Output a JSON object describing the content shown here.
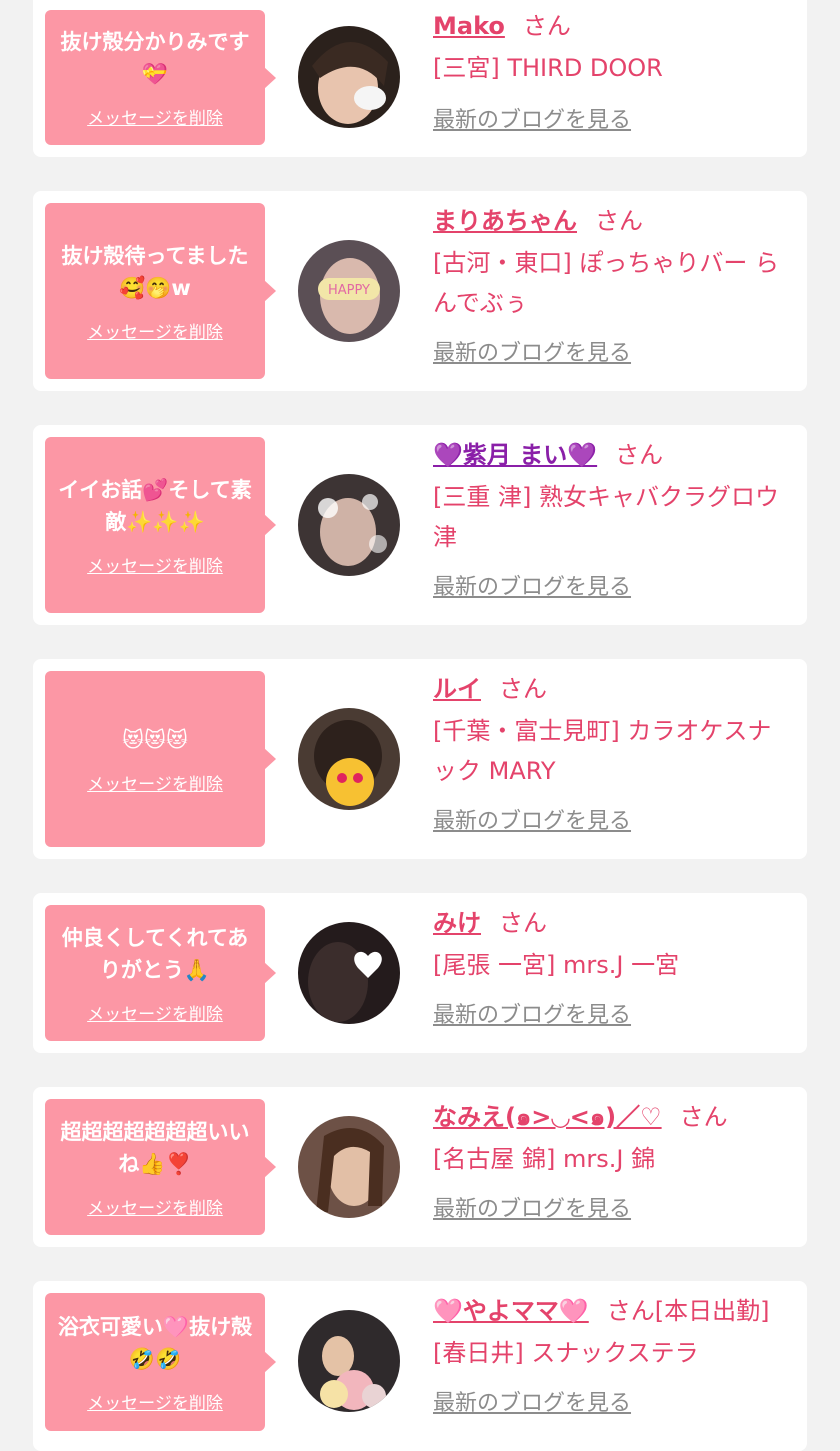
{
  "cards": [
    {
      "message": "抜け殻分かりみです💝",
      "delete_label": "メッセージを削除",
      "name": "Mako",
      "suffix": "さん",
      "shop": "[三宮] THIRD DOOR",
      "blog_label": "最新のブログを見る"
    },
    {
      "message": "抜け殻待ってました🥰🤭w",
      "delete_label": "メッセージを削除",
      "name": "まりあちゃん",
      "suffix": "さん",
      "shop": "[古河・東口] ぽっちゃりバー らんでぶぅ",
      "blog_label": "最新のブログを見る"
    },
    {
      "message": "イイお話💕そして素敵✨✨✨",
      "delete_label": "メッセージを削除",
      "name": "💜紫月 まい💜",
      "suffix": "さん",
      "shop": "[三重 津] 熟女キャバクラグロウ津",
      "blog_label": "最新のブログを見る"
    },
    {
      "message": "😻😻😻",
      "delete_label": "メッセージを削除",
      "name": "ルイ",
      "suffix": "さん",
      "shop": "[千葉・富士見町] カラオケスナック MARY",
      "blog_label": "最新のブログを見る"
    },
    {
      "message": "仲良くしてくれてありがとう🙏",
      "delete_label": "メッセージを削除",
      "name": "みけ",
      "suffix": "さん",
      "shop": "[尾張 一宮] mrs.J 一宮",
      "blog_label": "最新のブログを見る"
    },
    {
      "message": "超超超超超超超いいね👍❣️",
      "delete_label": "メッセージを削除",
      "name": "なみえ(๑>◡<๑)／♡",
      "suffix": "さん",
      "shop": "[名古屋 錦] mrs.J 錦",
      "blog_label": "最新のブログを見る"
    },
    {
      "message": "浴衣可愛い🩷抜け殻🤣🤣",
      "delete_label": "メッセージを削除",
      "name": "🩷やよママ🩷",
      "suffix": "さん[本日出勤]",
      "shop": "[春日井] スナックステラ",
      "blog_label": "最新のブログを見る"
    }
  ],
  "colors": {
    "page_bg": "#f2f2f2",
    "card_bg": "#ffffff",
    "bubble_bg": "#fc97a5",
    "accent": "#e4436b",
    "link_gray": "#8c8c8c"
  },
  "avatar_icons": [
    "avatar-photo-icon"
  ]
}
